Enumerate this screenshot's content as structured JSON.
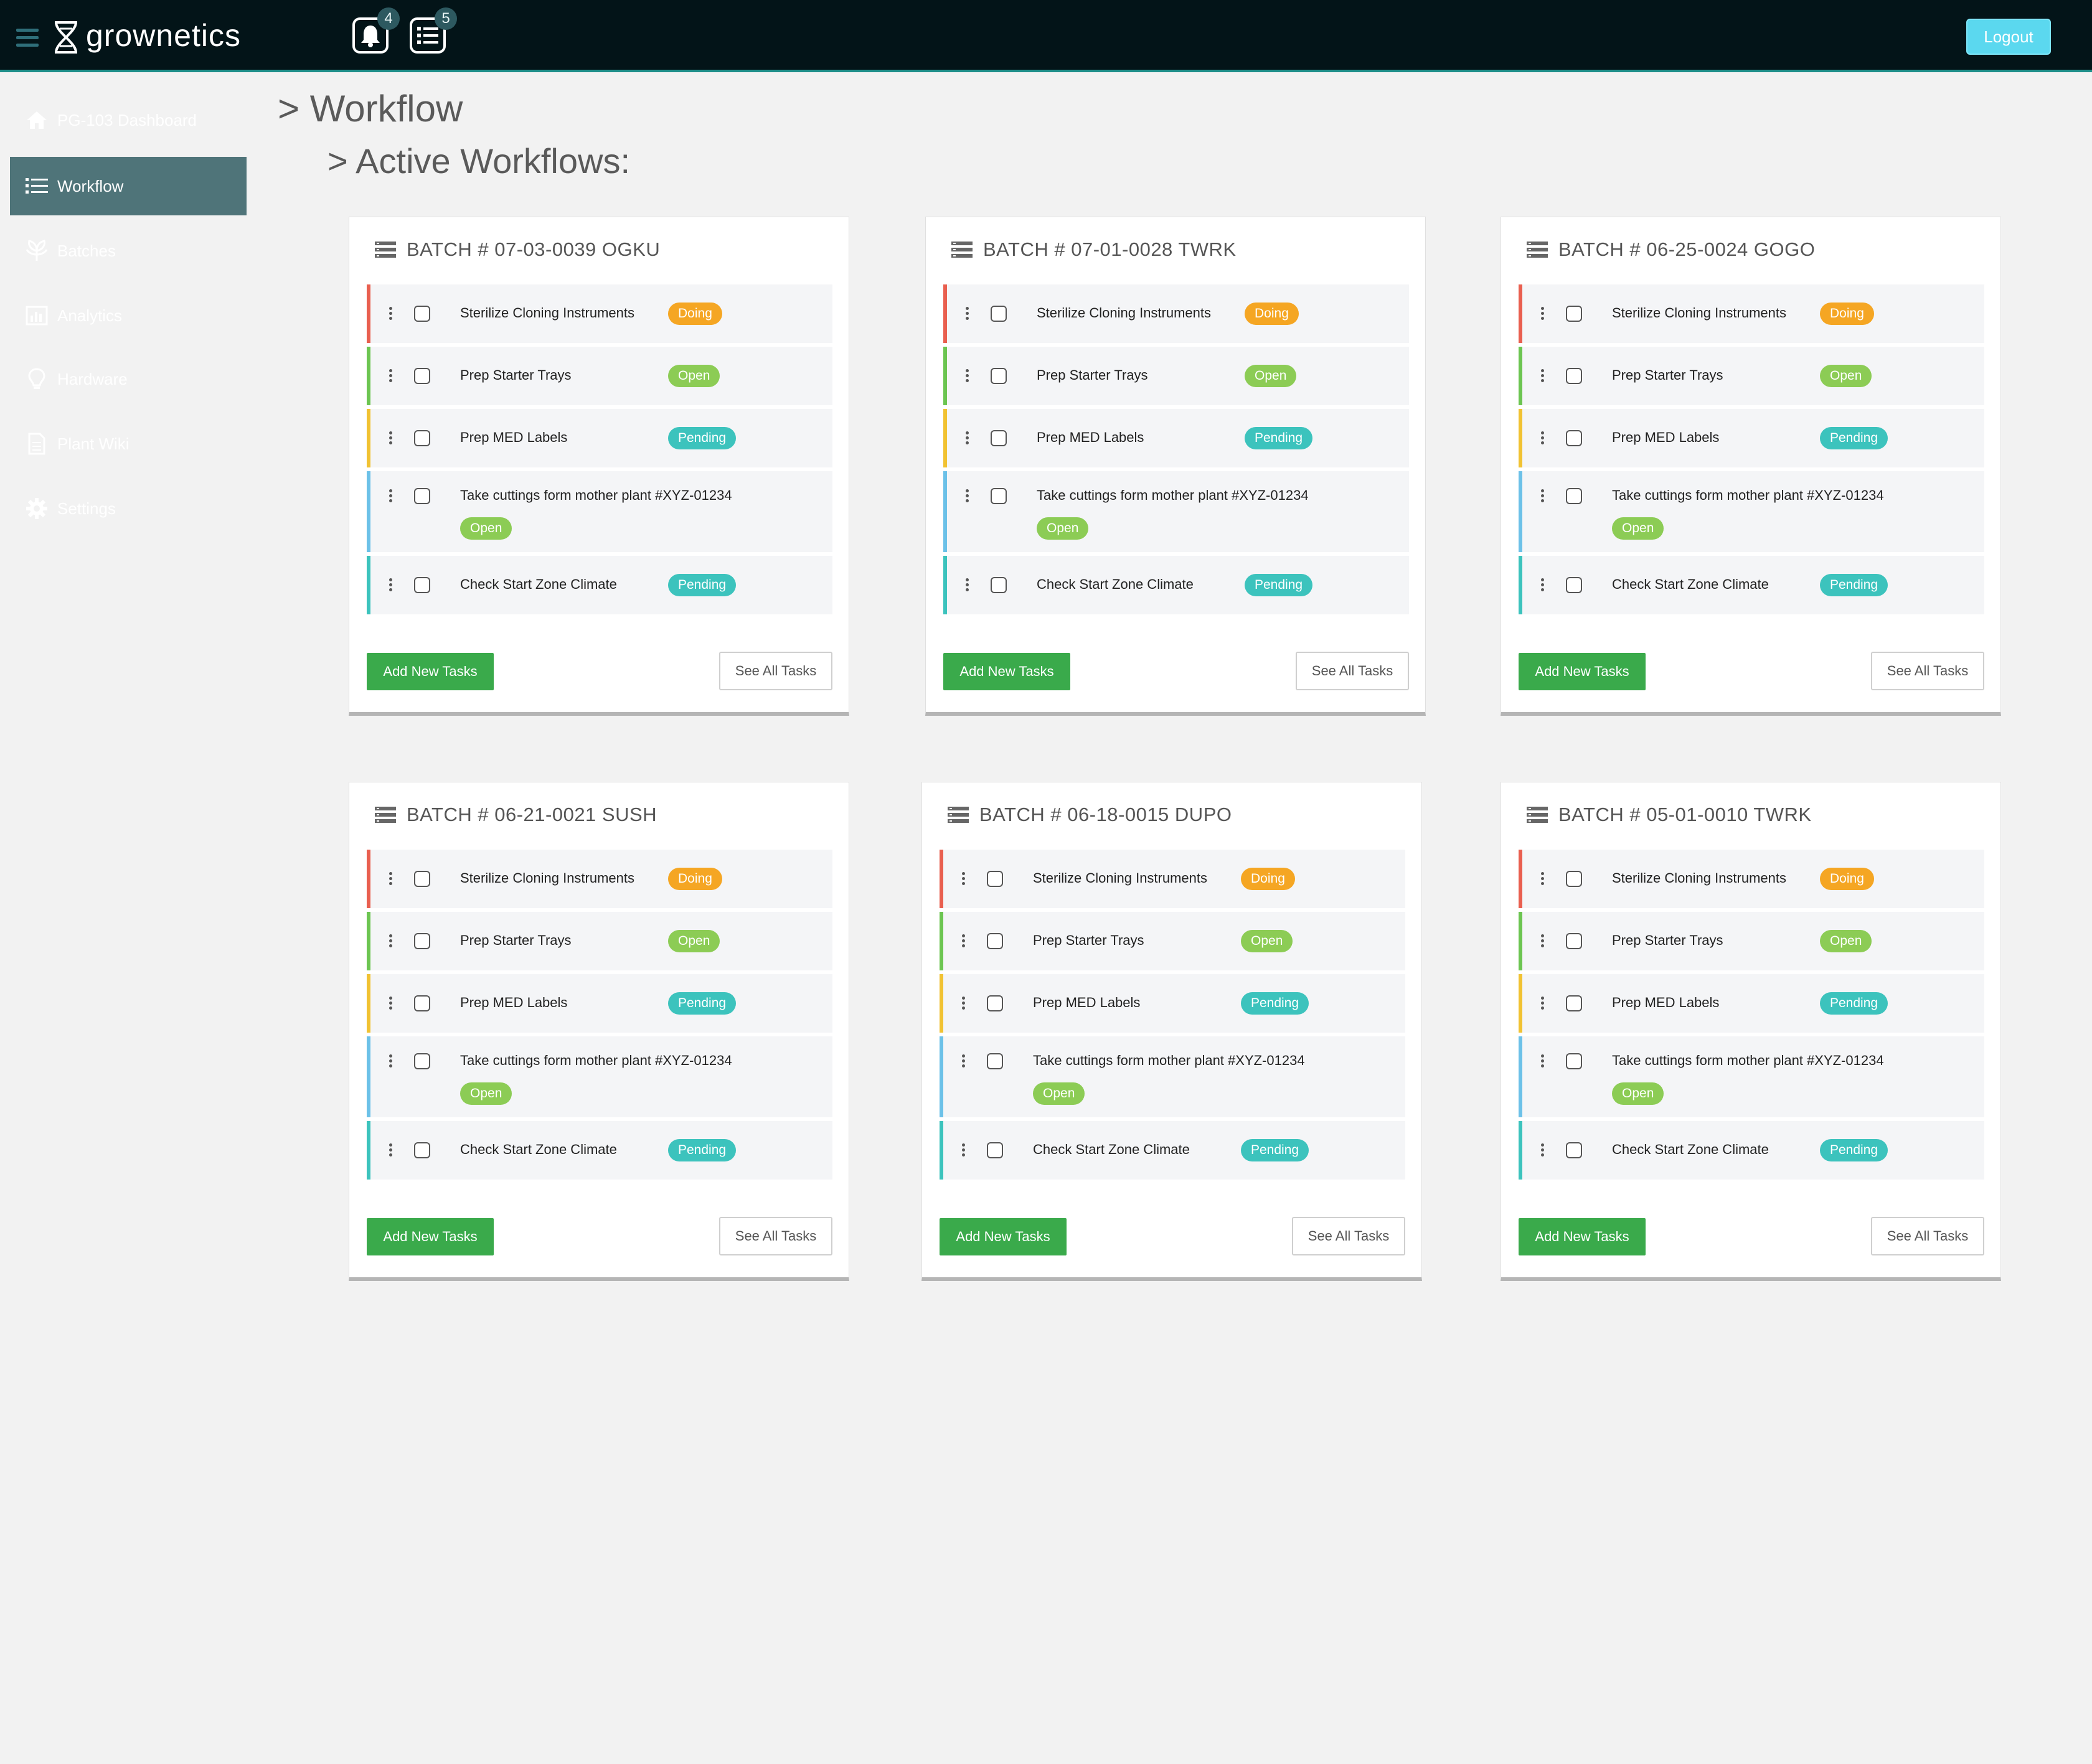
{
  "header": {
    "brand": "grownetics",
    "notifications_count": "4",
    "tasks_count": "5",
    "logout_label": "Logout"
  },
  "sidebar": {
    "items": [
      {
        "label": "PG-103 Dashboard",
        "icon": "home-icon"
      },
      {
        "label": "Workflow",
        "icon": "list-icon"
      },
      {
        "label": "Batches",
        "icon": "leaf-icon"
      },
      {
        "label": "Analytics",
        "icon": "chart-icon"
      },
      {
        "label": "Hardware",
        "icon": "lightbulb-icon"
      },
      {
        "label": "Plant Wiki",
        "icon": "document-icon"
      },
      {
        "label": "Settings",
        "icon": "gear-icon"
      }
    ]
  },
  "page": {
    "title": "> Workflow",
    "subtitle": "> Active Workflows:"
  },
  "colors": {
    "doing": "#f5a623",
    "open": "#8ccc55",
    "pending": "#3cc3bd",
    "border_red": "#e95f4f",
    "border_green": "#6cc551",
    "border_yellow": "#f1c232",
    "border_blue": "#6cc1e8",
    "border_teal": "#3cc3bd"
  },
  "cards": [
    {
      "title": "BATCH # 07-03-0039 OGKU",
      "add_label": "Add New Tasks",
      "see_label": "See All Tasks",
      "tasks": [
        {
          "label": "Sterilize Cloning Instruments",
          "status": "Doing"
        },
        {
          "label": "Prep Starter Trays",
          "status": "Open"
        },
        {
          "label": "Prep MED Labels",
          "status": "Pending"
        },
        {
          "label": "Take cuttings form mother plant #XYZ-01234",
          "status": "Open"
        },
        {
          "label": "Check Start Zone Climate",
          "status": "Pending"
        }
      ]
    },
    {
      "title": "BATCH # 07-01-0028 TWRK",
      "add_label": "Add New Tasks",
      "see_label": "See All Tasks",
      "tasks": [
        {
          "label": "Sterilize Cloning Instruments",
          "status": "Doing"
        },
        {
          "label": "Prep Starter Trays",
          "status": "Open"
        },
        {
          "label": "Prep MED Labels",
          "status": "Pending"
        },
        {
          "label": "Take cuttings form mother plant #XYZ-01234",
          "status": "Open"
        },
        {
          "label": "Check Start Zone Climate",
          "status": "Pending"
        }
      ]
    },
    {
      "title": "BATCH # 06-25-0024 GOGO",
      "add_label": "Add New Tasks",
      "see_label": "See All Tasks",
      "tasks": [
        {
          "label": "Sterilize Cloning Instruments",
          "status": "Doing"
        },
        {
          "label": "Prep Starter Trays",
          "status": "Open"
        },
        {
          "label": "Prep MED Labels",
          "status": "Pending"
        },
        {
          "label": "Take cuttings form mother plant #XYZ-01234",
          "status": "Open"
        },
        {
          "label": "Check Start Zone Climate",
          "status": "Pending"
        }
      ]
    },
    {
      "title": "BATCH # 06-21-0021 SUSH",
      "add_label": "Add New Tasks",
      "see_label": "See All Tasks",
      "tasks": [
        {
          "label": "Sterilize Cloning Instruments",
          "status": "Doing"
        },
        {
          "label": "Prep Starter Trays",
          "status": "Open"
        },
        {
          "label": "Prep MED Labels",
          "status": "Pending"
        },
        {
          "label": "Take cuttings form mother plant #XYZ-01234",
          "status": "Open"
        },
        {
          "label": "Check Start Zone Climate",
          "status": "Pending"
        }
      ]
    },
    {
      "title": "BATCH # 06-18-0015 DUPO",
      "add_label": "Add New Tasks",
      "see_label": "See All Tasks",
      "tasks": [
        {
          "label": "Sterilize Cloning Instruments",
          "status": "Doing"
        },
        {
          "label": "Prep Starter Trays",
          "status": "Open"
        },
        {
          "label": "Prep MED Labels",
          "status": "Pending"
        },
        {
          "label": "Take cuttings form mother plant #XYZ-01234",
          "status": "Open"
        },
        {
          "label": "Check Start Zone Climate",
          "status": "Pending"
        }
      ]
    },
    {
      "title": "BATCH # 05-01-0010 TWRK",
      "add_label": "Add New Tasks",
      "see_label": "See All Tasks",
      "tasks": [
        {
          "label": "Sterilize Cloning Instruments",
          "status": "Doing"
        },
        {
          "label": "Prep Starter Trays",
          "status": "Open"
        },
        {
          "label": "Prep MED Labels",
          "status": "Pending"
        },
        {
          "label": "Take cuttings form mother plant #XYZ-01234",
          "status": "Open"
        },
        {
          "label": "Check Start Zone Climate",
          "status": "Pending"
        }
      ]
    }
  ]
}
